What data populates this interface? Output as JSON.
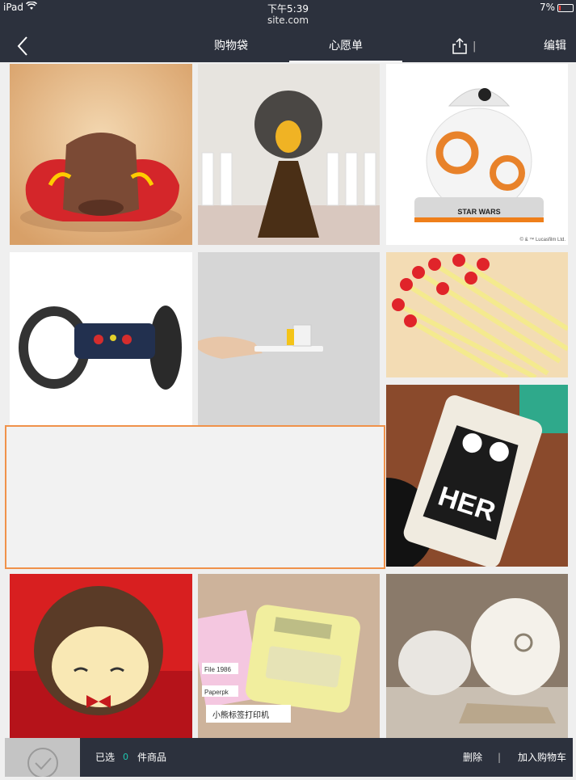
{
  "status_bar": {
    "device": "iPad",
    "time": "下午5:39",
    "url": "site.com",
    "battery": "7%"
  },
  "nav": {
    "tabs": [
      "购物袋",
      "心愿单"
    ],
    "active_tab": "心愿单",
    "edit_label": "编辑"
  },
  "products": [
    {
      "name": "靠垫"
    },
    {
      "name": "拖把玩偶"
    },
    {
      "name": "星球大战 BB-8 机器人",
      "brand_text": "STAR WARS",
      "copyright": "© & ™ Lucasfilm Ltd."
    },
    {
      "name": "遥控跳跃机器人"
    },
    {
      "name": "托盘装置"
    },
    {
      "name": "火柴造型笔"
    },
    {
      "name": "移动电源",
      "print_text": "HER"
    },
    {
      "name": "小猴子玩偶"
    },
    {
      "name": "小熊标签打印机",
      "print_texts": [
        "File 1986",
        "小熊标签打印机",
        "Paperpk"
      ]
    },
    {
      "name": "海螺摆件"
    }
  ],
  "bottom_bar": {
    "selected_prefix": "已选",
    "selected_count": "0",
    "selected_suffix": "件商品",
    "delete_label": "删除",
    "add_to_cart_label": "加入购物车"
  }
}
